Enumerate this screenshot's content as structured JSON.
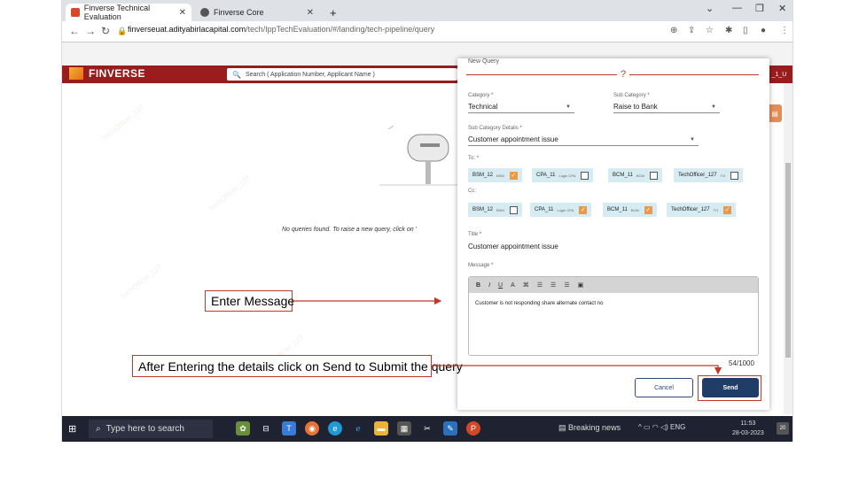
{
  "browser": {
    "tabs": [
      {
        "label": "Finverse Technical Evaluation",
        "active": true
      },
      {
        "label": "Finverse Core",
        "active": false
      }
    ],
    "new_tab": "+",
    "url_host": "finverseuat.adityabirlacapital.com",
    "url_path": "/tech/IppTechEvaluation/#/landing/tech-pipeline/query",
    "win_minimize": "—",
    "win_restore": "❐",
    "win_close": "✕"
  },
  "app": {
    "brand": "FINVERSE",
    "search_placeholder": "Search ( Application Number, Applicant Name )",
    "user_chip": "_1_U"
  },
  "content": {
    "empty_message": "No queries found. To raise a new query, click on '"
  },
  "modal": {
    "title": "New Query",
    "category_label": "Category",
    "category_value": "Technical",
    "subcategory_label": "Sub Category",
    "subcategory_value": "Raise to Bank",
    "subcat_details_label": "Sub Category Details",
    "subcat_details_value": "Customer appointment issue",
    "to_label": "To:",
    "to_chips": [
      {
        "name": "BSM_12",
        "role": "BSM",
        "checked": true
      },
      {
        "name": "CPA_11",
        "role": "Login CPA",
        "checked": false
      },
      {
        "name": "BCM_11",
        "role": "BCM",
        "checked": false
      },
      {
        "name": "TechOfficer_127",
        "role": "TO",
        "checked": false
      }
    ],
    "cc_label": "Cc:",
    "cc_chips": [
      {
        "name": "BSM_12",
        "role": "BSM",
        "checked": false
      },
      {
        "name": "CPA_11",
        "role": "Login CPA",
        "checked": true
      },
      {
        "name": "BCM_11",
        "role": "BCM",
        "checked": true
      },
      {
        "name": "TechOfficer_127",
        "role": "TO",
        "checked": true
      }
    ],
    "title_label": "Title",
    "title_value": "Customer appointment issue",
    "message_label": "Message",
    "toolbar": [
      "B",
      "I",
      "U",
      "A",
      "⌘",
      "☰",
      "☰",
      "☰",
      "▣"
    ],
    "message_value": "Customer is not responding share alternate contact no",
    "counter": "54/1000",
    "cancel_label": "Cancel",
    "send_label": "Send"
  },
  "taskbar": {
    "search_placeholder": "Type here to search",
    "news": "Breaking news",
    "lang": "ENG",
    "time": "11:53",
    "date": "28-03-2023",
    "notif": "20"
  },
  "annotations": {
    "enter_message": "Enter Message",
    "after_entering": "After Entering the details click on Send to Submit the query"
  },
  "colors": {
    "brand_red": "#9b1c1c",
    "send_blue": "#1f3d66",
    "checkbox_orange": "#e89a4a",
    "chip_bg": "#d6ecf2",
    "callout_red": "#c0392b"
  }
}
